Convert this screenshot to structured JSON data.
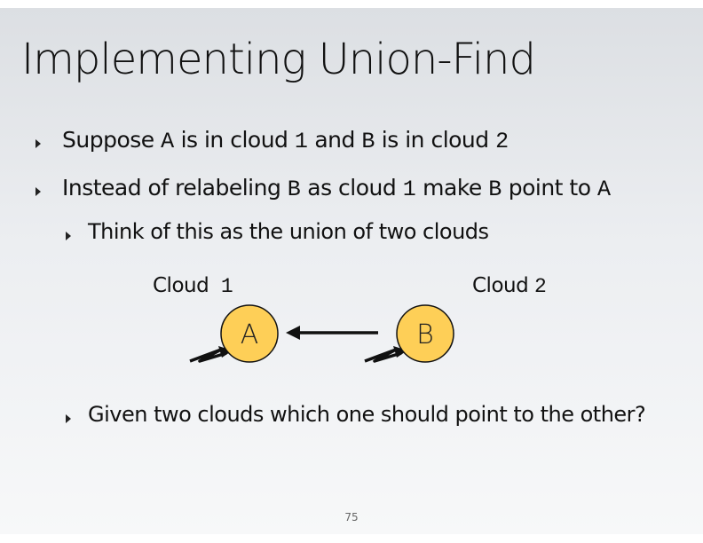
{
  "title": "Implementing Union-Find",
  "bullets": [
    {
      "parts": [
        "Suppose ",
        "A",
        " is in cloud ",
        "1",
        " and ",
        "B",
        " is in cloud ",
        "2"
      ]
    },
    {
      "parts": [
        "Instead of relabeling ",
        "B",
        " as cloud ",
        "1",
        " make ",
        "B",
        " point to ",
        "A"
      ]
    },
    {
      "text": "Think of this as the union of two clouds"
    },
    {
      "text": "Given two clouds which one should point to the other?"
    }
  ],
  "diagram": {
    "cloud1_label": "Cloud",
    "cloud1_id": "1",
    "cloud2_label": "Cloud",
    "cloud2_id": "2",
    "node_a": "A",
    "node_b": "B",
    "node_fill": "#fecf57"
  },
  "page_number": "75"
}
